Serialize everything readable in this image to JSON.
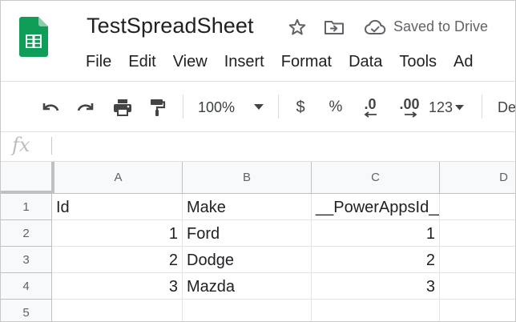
{
  "document": {
    "title": "TestSpreadSheet",
    "save_status": "Saved to Drive"
  },
  "menu": [
    "File",
    "Edit",
    "View",
    "Insert",
    "Format",
    "Data",
    "Tools",
    "Ad"
  ],
  "toolbar": {
    "zoom": "100%",
    "currency": "$",
    "percent": "%",
    "decrease_decimal": ".0",
    "increase_decimal": ".00",
    "number_format": "123",
    "font_partial": "De"
  },
  "formula_bar": {
    "fx": "fx",
    "value": ""
  },
  "grid": {
    "columns": [
      "A",
      "B",
      "C",
      "D"
    ],
    "rows": [
      "1",
      "2",
      "3",
      "4",
      "5"
    ],
    "cells": [
      [
        "Id",
        "Make",
        "__PowerAppsId__",
        ""
      ],
      [
        "1",
        "Ford",
        "1",
        ""
      ],
      [
        "2",
        "Dodge",
        "2",
        ""
      ],
      [
        "3",
        "Mazda",
        "3",
        ""
      ],
      [
        "",
        "",
        "",
        ""
      ]
    ]
  },
  "colors": {
    "sheets_green": "#0F9D58",
    "header_bg": "#f8f9fa",
    "gridline": "#e2e3e3"
  }
}
